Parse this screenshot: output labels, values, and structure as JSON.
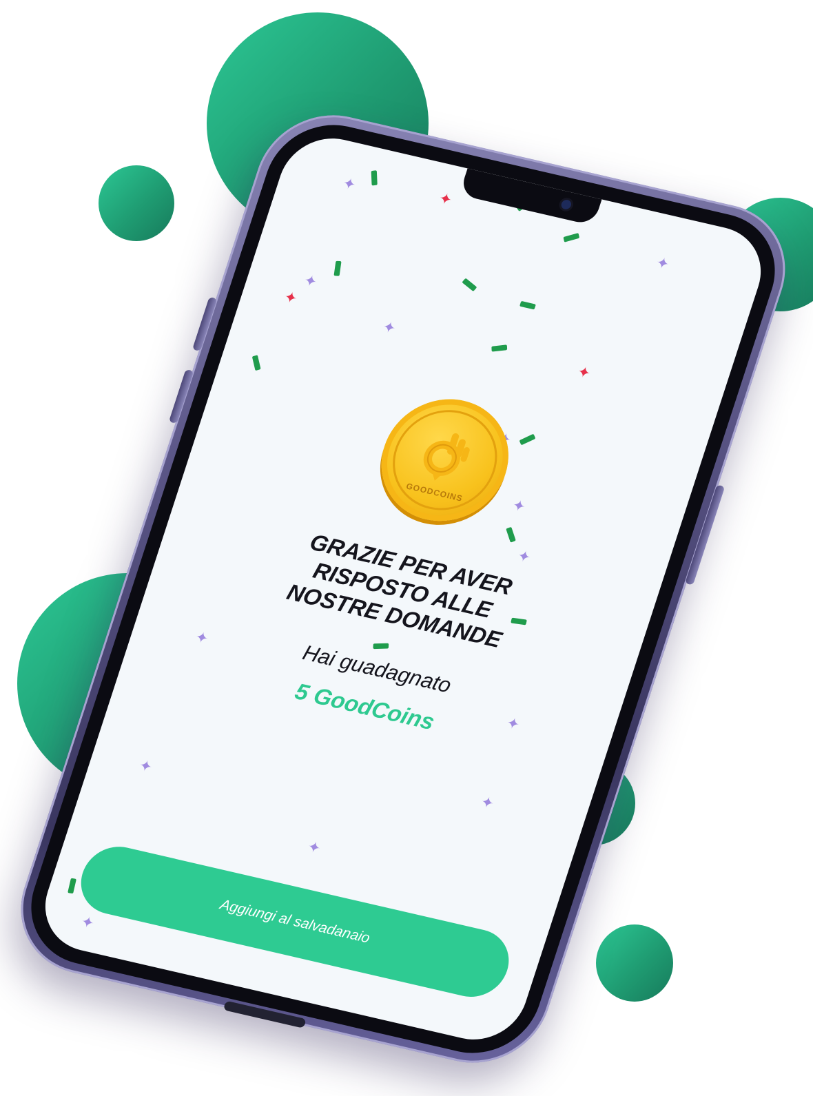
{
  "screen": {
    "title_lines": [
      "GRAZIE PER AVER",
      "RISPOSTO ALLE",
      "NOSTRE DOMANDE"
    ],
    "subtitle": "Hai guadagnato",
    "reward": "5 GoodCoins",
    "cta_label": "Aggiungi al salvadanaio"
  },
  "coin": {
    "label": "GOODCOINS",
    "icon": "hand-ok-icon"
  },
  "colors": {
    "accent": "#2ecb92",
    "bubble": "#1f9c72",
    "coin": "#f8c21d",
    "confetti_green": "#1f9c4c",
    "star_purple": "#a08be0",
    "star_red": "#e6304a"
  }
}
